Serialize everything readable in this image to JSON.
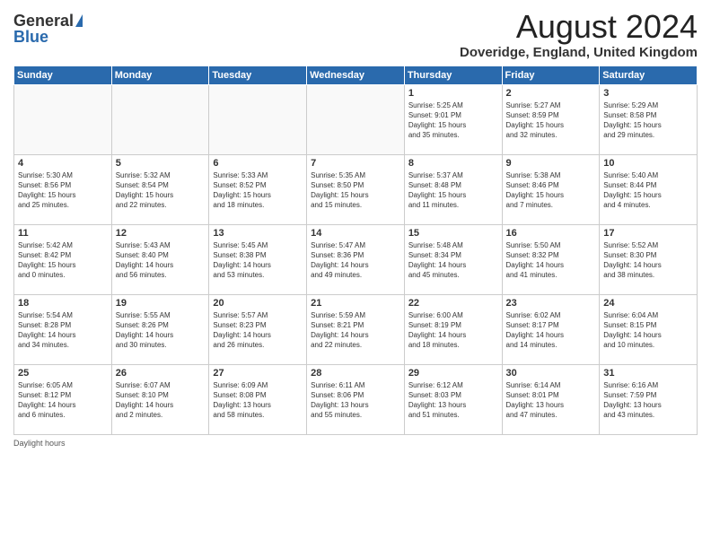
{
  "header": {
    "logo_general": "General",
    "logo_blue": "Blue",
    "month_year": "August 2024",
    "location": "Doveridge, England, United Kingdom"
  },
  "days_of_week": [
    "Sunday",
    "Monday",
    "Tuesday",
    "Wednesday",
    "Thursday",
    "Friday",
    "Saturday"
  ],
  "weeks": [
    [
      {
        "day": "",
        "info": ""
      },
      {
        "day": "",
        "info": ""
      },
      {
        "day": "",
        "info": ""
      },
      {
        "day": "",
        "info": ""
      },
      {
        "day": "1",
        "info": "Sunrise: 5:25 AM\nSunset: 9:01 PM\nDaylight: 15 hours\nand 35 minutes."
      },
      {
        "day": "2",
        "info": "Sunrise: 5:27 AM\nSunset: 8:59 PM\nDaylight: 15 hours\nand 32 minutes."
      },
      {
        "day": "3",
        "info": "Sunrise: 5:29 AM\nSunset: 8:58 PM\nDaylight: 15 hours\nand 29 minutes."
      }
    ],
    [
      {
        "day": "4",
        "info": "Sunrise: 5:30 AM\nSunset: 8:56 PM\nDaylight: 15 hours\nand 25 minutes."
      },
      {
        "day": "5",
        "info": "Sunrise: 5:32 AM\nSunset: 8:54 PM\nDaylight: 15 hours\nand 22 minutes."
      },
      {
        "day": "6",
        "info": "Sunrise: 5:33 AM\nSunset: 8:52 PM\nDaylight: 15 hours\nand 18 minutes."
      },
      {
        "day": "7",
        "info": "Sunrise: 5:35 AM\nSunset: 8:50 PM\nDaylight: 15 hours\nand 15 minutes."
      },
      {
        "day": "8",
        "info": "Sunrise: 5:37 AM\nSunset: 8:48 PM\nDaylight: 15 hours\nand 11 minutes."
      },
      {
        "day": "9",
        "info": "Sunrise: 5:38 AM\nSunset: 8:46 PM\nDaylight: 15 hours\nand 7 minutes."
      },
      {
        "day": "10",
        "info": "Sunrise: 5:40 AM\nSunset: 8:44 PM\nDaylight: 15 hours\nand 4 minutes."
      }
    ],
    [
      {
        "day": "11",
        "info": "Sunrise: 5:42 AM\nSunset: 8:42 PM\nDaylight: 15 hours\nand 0 minutes."
      },
      {
        "day": "12",
        "info": "Sunrise: 5:43 AM\nSunset: 8:40 PM\nDaylight: 14 hours\nand 56 minutes."
      },
      {
        "day": "13",
        "info": "Sunrise: 5:45 AM\nSunset: 8:38 PM\nDaylight: 14 hours\nand 53 minutes."
      },
      {
        "day": "14",
        "info": "Sunrise: 5:47 AM\nSunset: 8:36 PM\nDaylight: 14 hours\nand 49 minutes."
      },
      {
        "day": "15",
        "info": "Sunrise: 5:48 AM\nSunset: 8:34 PM\nDaylight: 14 hours\nand 45 minutes."
      },
      {
        "day": "16",
        "info": "Sunrise: 5:50 AM\nSunset: 8:32 PM\nDaylight: 14 hours\nand 41 minutes."
      },
      {
        "day": "17",
        "info": "Sunrise: 5:52 AM\nSunset: 8:30 PM\nDaylight: 14 hours\nand 38 minutes."
      }
    ],
    [
      {
        "day": "18",
        "info": "Sunrise: 5:54 AM\nSunset: 8:28 PM\nDaylight: 14 hours\nand 34 minutes."
      },
      {
        "day": "19",
        "info": "Sunrise: 5:55 AM\nSunset: 8:26 PM\nDaylight: 14 hours\nand 30 minutes."
      },
      {
        "day": "20",
        "info": "Sunrise: 5:57 AM\nSunset: 8:23 PM\nDaylight: 14 hours\nand 26 minutes."
      },
      {
        "day": "21",
        "info": "Sunrise: 5:59 AM\nSunset: 8:21 PM\nDaylight: 14 hours\nand 22 minutes."
      },
      {
        "day": "22",
        "info": "Sunrise: 6:00 AM\nSunset: 8:19 PM\nDaylight: 14 hours\nand 18 minutes."
      },
      {
        "day": "23",
        "info": "Sunrise: 6:02 AM\nSunset: 8:17 PM\nDaylight: 14 hours\nand 14 minutes."
      },
      {
        "day": "24",
        "info": "Sunrise: 6:04 AM\nSunset: 8:15 PM\nDaylight: 14 hours\nand 10 minutes."
      }
    ],
    [
      {
        "day": "25",
        "info": "Sunrise: 6:05 AM\nSunset: 8:12 PM\nDaylight: 14 hours\nand 6 minutes."
      },
      {
        "day": "26",
        "info": "Sunrise: 6:07 AM\nSunset: 8:10 PM\nDaylight: 14 hours\nand 2 minutes."
      },
      {
        "day": "27",
        "info": "Sunrise: 6:09 AM\nSunset: 8:08 PM\nDaylight: 13 hours\nand 58 minutes."
      },
      {
        "day": "28",
        "info": "Sunrise: 6:11 AM\nSunset: 8:06 PM\nDaylight: 13 hours\nand 55 minutes."
      },
      {
        "day": "29",
        "info": "Sunrise: 6:12 AM\nSunset: 8:03 PM\nDaylight: 13 hours\nand 51 minutes."
      },
      {
        "day": "30",
        "info": "Sunrise: 6:14 AM\nSunset: 8:01 PM\nDaylight: 13 hours\nand 47 minutes."
      },
      {
        "day": "31",
        "info": "Sunrise: 6:16 AM\nSunset: 7:59 PM\nDaylight: 13 hours\nand 43 minutes."
      }
    ]
  ],
  "footer": {
    "daylight_hours": "Daylight hours"
  }
}
